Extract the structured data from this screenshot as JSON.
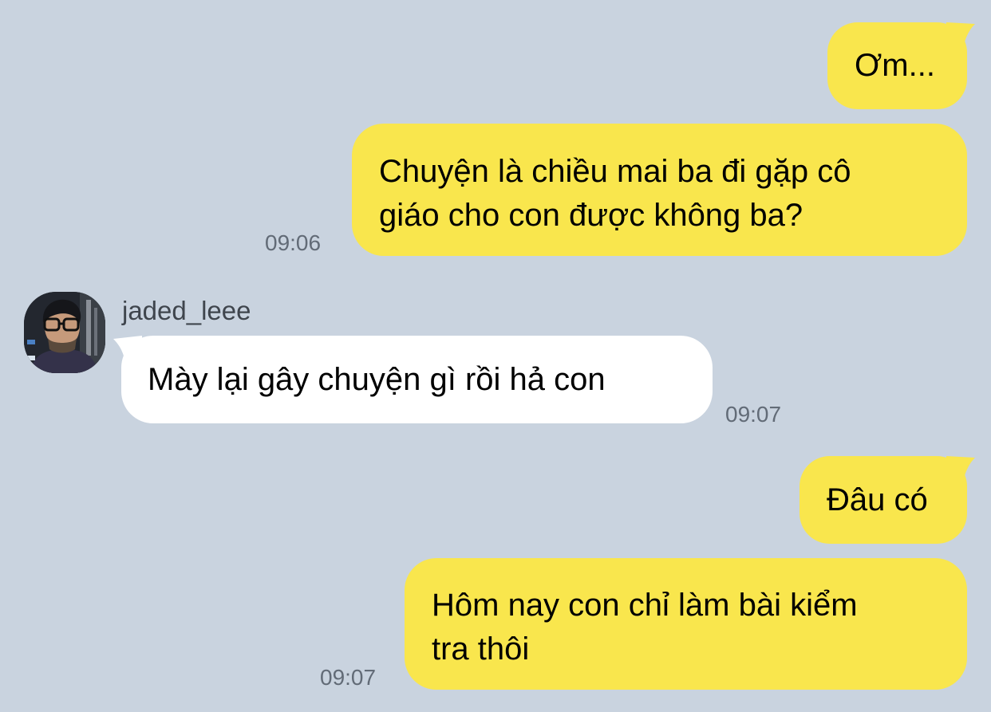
{
  "contact": {
    "username": "jaded_leee",
    "avatar_icon": "profile-photo-avatar"
  },
  "colors": {
    "background": "#c9d3df",
    "outgoing_bubble": "#f9e64d",
    "incoming_bubble": "#ffffff",
    "timestamp": "#626b77"
  },
  "messages": [
    {
      "direction": "outgoing",
      "lines": [
        "Ơm..."
      ],
      "time": ""
    },
    {
      "direction": "outgoing",
      "lines": [
        "Chuyện là chiều mai ba đi gặp cô",
        "giáo cho con được không ba?"
      ],
      "time": "09:06"
    },
    {
      "direction": "incoming",
      "lines": [
        "Mày lại gây chuyện gì rồi hả con"
      ],
      "time": "09:07"
    },
    {
      "direction": "outgoing",
      "lines": [
        "Đâu có"
      ],
      "time": ""
    },
    {
      "direction": "outgoing",
      "lines": [
        "Hôm nay con chỉ làm bài kiểm",
        "tra thôi"
      ],
      "time": "09:07"
    }
  ]
}
